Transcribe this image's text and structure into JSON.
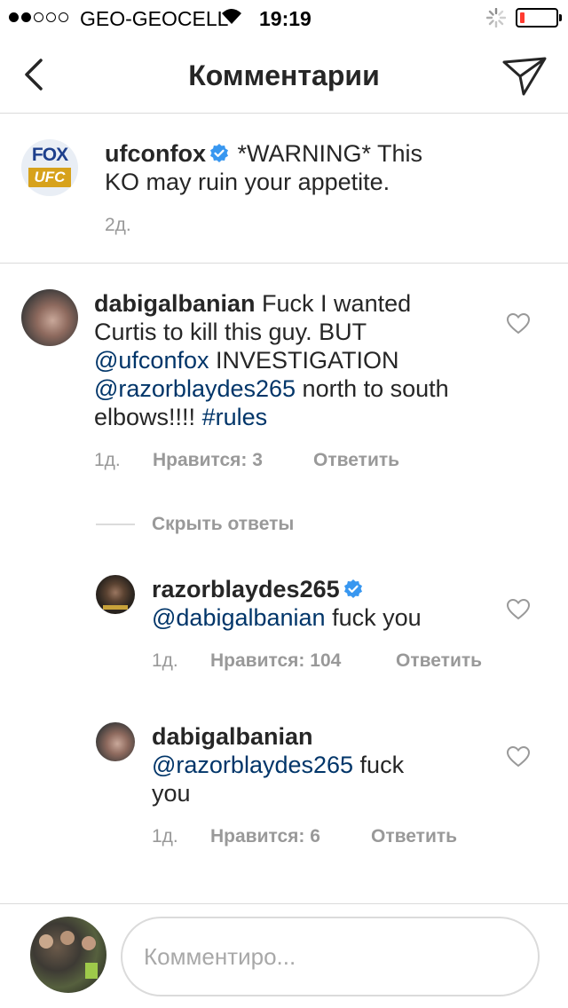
{
  "status_bar": {
    "carrier": "GEO-GEOCELL",
    "time": "19:19",
    "signal_bars_filled": 2,
    "signal_bars_total": 5,
    "battery_level_percent": 10
  },
  "nav": {
    "title": "Комментарии",
    "back_icon": "chevron-left-icon",
    "send_icon": "paper-plane-icon"
  },
  "caption": {
    "username": "ufconfox",
    "verified": true,
    "text": "*WARNING* This KO may ruin your appetite.",
    "age": "2д.",
    "logo_text_top": "FOX",
    "logo_text_bottom": "UFC"
  },
  "comments": [
    {
      "username": "dabigalbanian",
      "text_1": "Fuck I wanted Curtis to kill this guy. BUT ",
      "mention_1": "@ufconfox",
      "text_2": " INVESTIGATION ",
      "mention_2": "@razorblaydes265",
      "text_3": " north to south elbows!!!! ",
      "hashtag": "#rules",
      "age": "1д.",
      "likes": "Нравится: 3",
      "reply": "Ответить"
    }
  ],
  "hide_replies": "Скрыть ответы",
  "replies": [
    {
      "username": "razorblaydes265",
      "verified": true,
      "mention": "@dabigalbanian",
      "text": " fuck you",
      "age": "1д.",
      "likes": "Нравится: 104",
      "reply": "Ответить"
    },
    {
      "username": "dabigalbanian",
      "mention": "@razorblaydes265",
      "text": " fuck you",
      "age": "1д.",
      "likes": "Нравится: 6",
      "reply": "Ответить"
    }
  ],
  "composer": {
    "placeholder": "Комментиро..."
  },
  "colors": {
    "link": "#003569",
    "verified": "#3897f0",
    "meta": "#999999",
    "divider": "#dbdbdb",
    "battery_low": "#ff3b30"
  }
}
